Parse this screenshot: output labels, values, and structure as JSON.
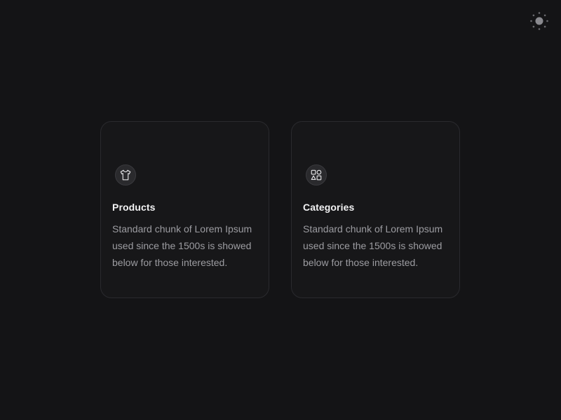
{
  "header": {
    "theme_toggle_icon": "sun-icon"
  },
  "cards": [
    {
      "icon": "tshirt-icon",
      "title": "Products",
      "description": "Standard chunk of Lorem Ipsum used since the 1500s is showed below for those interested."
    },
    {
      "icon": "shapes-icon",
      "title": "Categories",
      "description": "Standard chunk of Lorem Ipsum used since the 1500s is showed below for those interested."
    }
  ],
  "colors": {
    "background": "#141416",
    "card_background": "#171719",
    "card_border": "#2a2a2e",
    "title_text": "#f2f2f3",
    "body_text": "#9c9ca1"
  }
}
